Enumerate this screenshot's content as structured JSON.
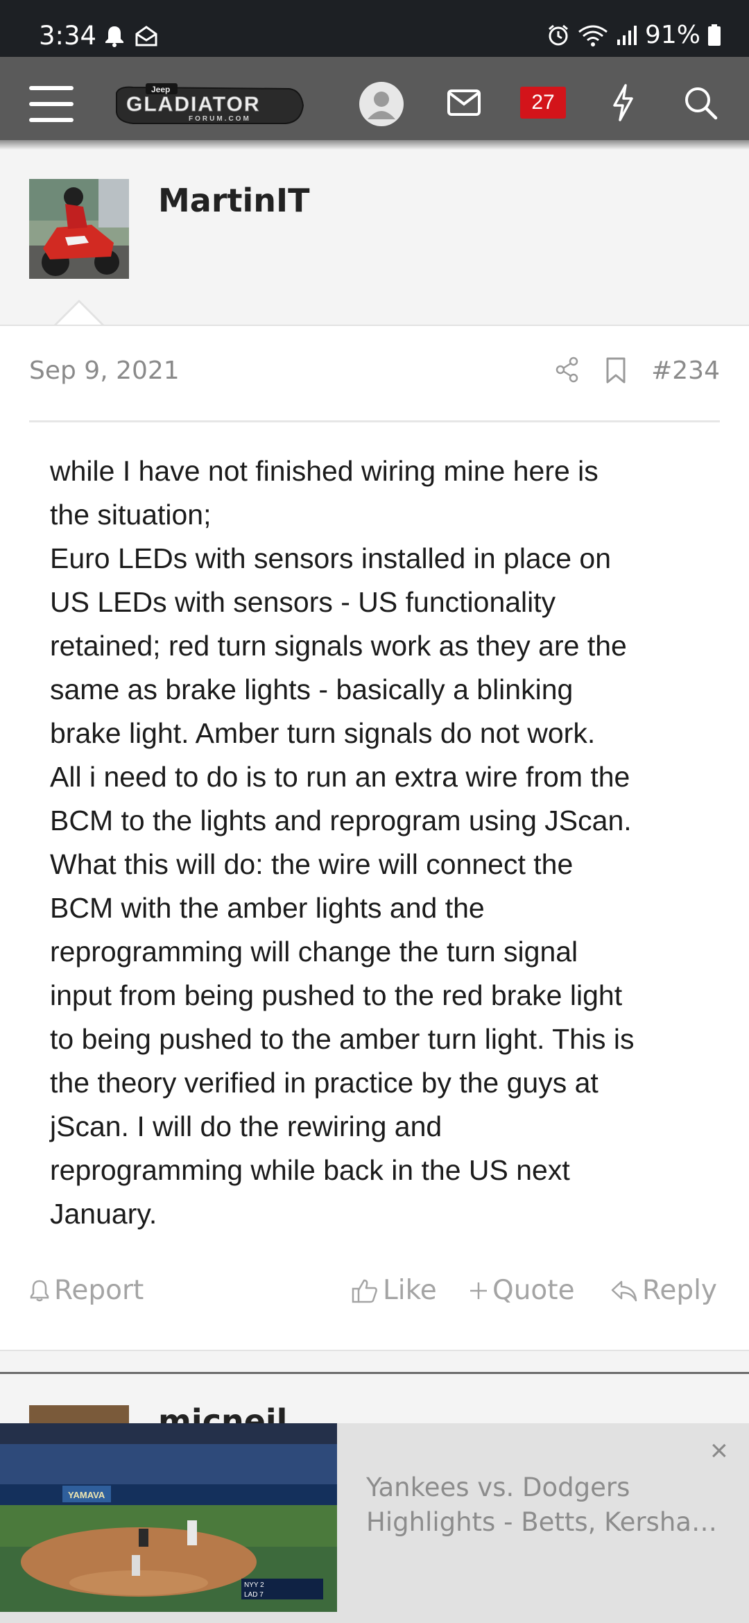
{
  "status_bar": {
    "time": "3:34",
    "battery": "91%",
    "icons_left": [
      "bell-icon",
      "mail-open-icon"
    ],
    "icons_right": [
      "alarm-icon",
      "wifi-icon",
      "signal-icon",
      "battery-icon"
    ]
  },
  "header": {
    "logo_top": "Jeep",
    "logo_main": "GLADIATOR",
    "logo_sub": "FORUM.COM",
    "notification_count": "27",
    "icons": [
      "menu-icon",
      "user-avatar-icon",
      "mail-icon",
      "bolt-icon",
      "search-icon"
    ]
  },
  "post": {
    "username": "MartinIT",
    "date": "Sep 9, 2021",
    "number": "#234",
    "body_lines": [
      "while I have not finished wiring mine here is",
      "the situation;",
      "Euro LEDs with sensors installed in place on",
      "US LEDs with sensors - US functionality",
      "retained; red turn signals work as they are the",
      "same as brake lights - basically a blinking",
      "brake light. Amber turn signals do not work.",
      "All i need to do is to run an extra wire from the",
      "BCM to the lights and reprogram using JScan.",
      "What this will do: the wire will connect the",
      "BCM with the amber lights and the",
      "reprogramming will change the turn signal",
      "input from being pushed to the red brake light",
      "to being pushed to the amber turn light. This is",
      "the theory verified in practice by the guys at",
      "jScan. I will do the rewiring and",
      "reprogramming while back in the US next",
      "January."
    ],
    "actions": {
      "report": "Report",
      "like": "Like",
      "quote": "Quote",
      "reply": "Reply"
    }
  },
  "next_post": {
    "username_partial": "micneil"
  },
  "ad": {
    "title_line1": "Yankees vs. Dodgers",
    "title_line2": "Highlights - Betts, Kershaw…",
    "close": "×",
    "scoreboard_top": "NYY 2",
    "scoreboard_bottom": "LAD 7",
    "banner_text": "YAMAVA"
  },
  "colors": {
    "appbar": "#5a5a5a",
    "status_bar": "#1d2024",
    "badge": "#d3141a",
    "muted_text": "#8a8a8a"
  }
}
